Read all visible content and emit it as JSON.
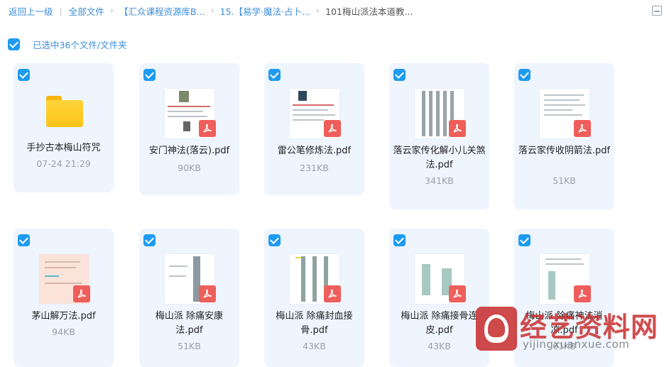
{
  "breadcrumb": {
    "back": "返回上一级",
    "all_files": "全部文件",
    "level1": "【汇众课程资源库B...",
    "level2": "15.【易学·魔法·占卜...",
    "current": "101梅山派法本道教..."
  },
  "selection": {
    "label": "已选中36个文件/文件夹"
  },
  "files": [
    {
      "name": "手抄古本梅山符咒",
      "meta": "07-24 21:29",
      "type": "folder"
    },
    {
      "name": "安门神法(落云).pdf",
      "meta": "90KB",
      "type": "pdf"
    },
    {
      "name": "雷公笔修炼法.pdf",
      "meta": "231KB",
      "type": "pdf"
    },
    {
      "name": "落云家传化解小儿关煞法.pdf",
      "meta": "341KB",
      "type": "pdf"
    },
    {
      "name": "落云家传收阴箭法.pdf",
      "meta": "51KB",
      "type": "pdf"
    },
    {
      "name": "茅山解万法.pdf",
      "meta": "94KB",
      "type": "pdf"
    },
    {
      "name": "梅山派 除痛安康法.pdf",
      "meta": "51KB",
      "type": "pdf"
    },
    {
      "name": "梅山派 除痛封血接骨.pdf",
      "meta": "43KB",
      "type": "pdf"
    },
    {
      "name": "梅山派 除痛接骨连皮.pdf",
      "meta": "43KB",
      "type": "pdf"
    },
    {
      "name": "梅山派 除痛神法消凉.pdf",
      "meta": "61KB",
      "type": "pdf"
    }
  ],
  "watermark": {
    "title": "经艺资料网",
    "url": "yijingxuanxue.com"
  },
  "colors": {
    "accent": "#1e9bf0",
    "link": "#3c8ddc",
    "card_bg": "#eef5fe",
    "pdf_red": "#ee5e5b",
    "folder_yellow": "#fcc419"
  },
  "icons": [
    "checkbox-checked-icon",
    "folder-icon",
    "pdf-icon",
    "list-view-icon",
    "watermark-logo-icon"
  ]
}
